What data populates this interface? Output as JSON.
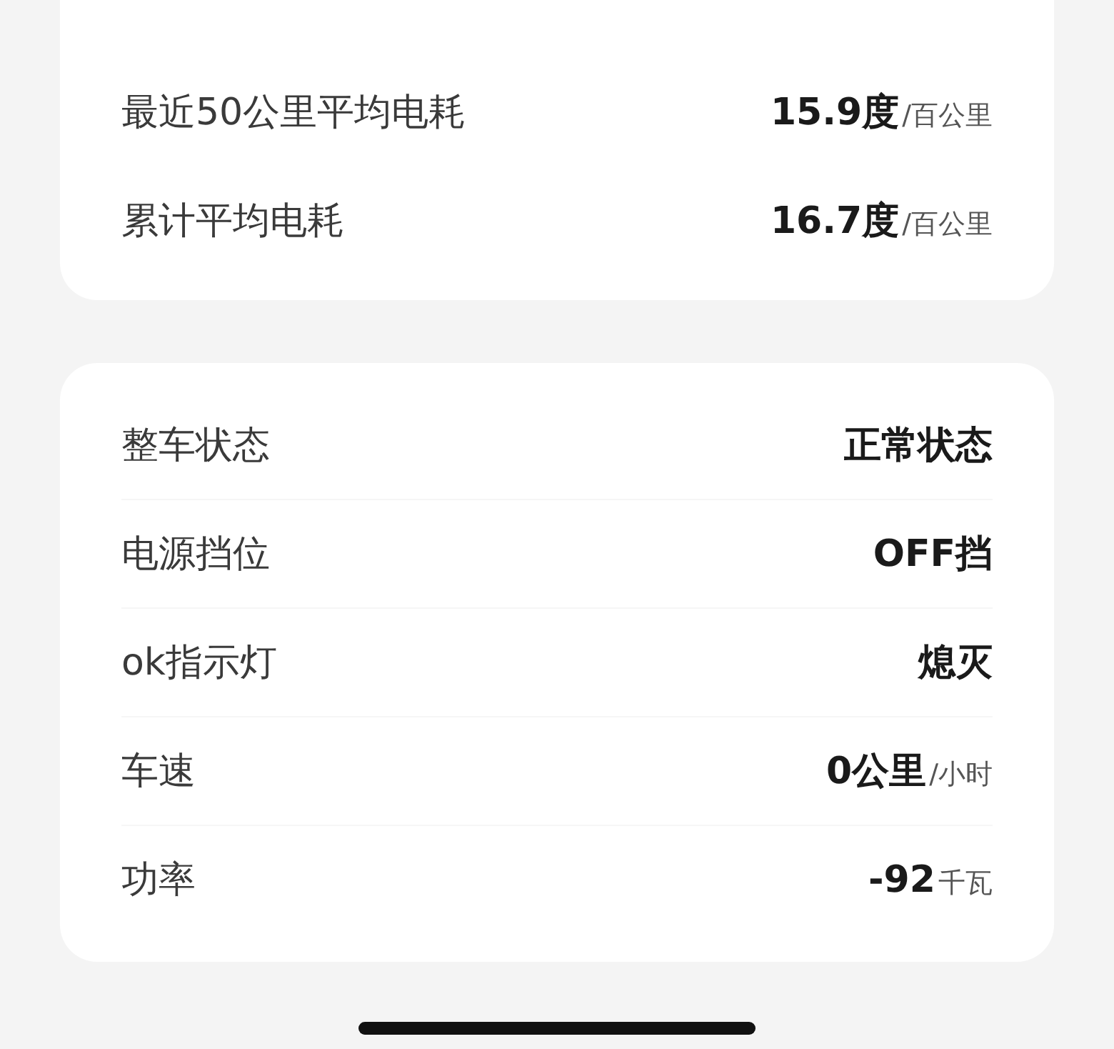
{
  "summary_card": {
    "rows": [
      {
        "label": "最近50公里平均电耗",
        "value": "15.9度",
        "unit": "/百公里"
      },
      {
        "label": "累计平均电耗",
        "value": "16.7度",
        "unit": "/百公里"
      }
    ]
  },
  "status_card": {
    "rows": [
      {
        "label": "整车状态",
        "value": "正常状态"
      },
      {
        "label": "电源挡位",
        "value": "OFF挡"
      },
      {
        "label": "ok指示灯",
        "value": "熄灭"
      },
      {
        "label": "车速",
        "value": "0公里",
        "unit": "/小时"
      },
      {
        "label": "功率",
        "value": "-92",
        "unit": "千瓦"
      }
    ]
  }
}
